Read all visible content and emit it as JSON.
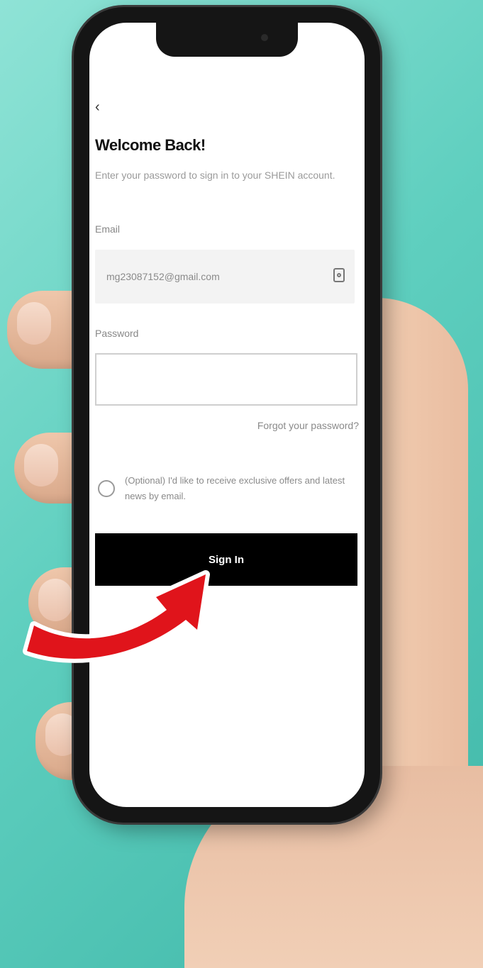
{
  "login": {
    "title": "Welcome Back!",
    "subtitle": "Enter your password to sign in to your SHEIN account.",
    "email_label": "Email",
    "email_value": "mg23087152@gmail.com",
    "password_label": "Password",
    "password_value": "",
    "forgot_password": "Forgot your password?",
    "optin_label": "(Optional) I'd like to receive exclusive offers and latest news by email.",
    "signin_button": "Sign In"
  },
  "icons": {
    "back": "back-arrow-icon",
    "email_field": "contact-card-icon",
    "overlay_arrow": "curved-red-arrow"
  },
  "colors": {
    "background": "#5fcfbf",
    "button": "#000000",
    "button_text": "#ffffff",
    "arrow": "#e0141b"
  }
}
